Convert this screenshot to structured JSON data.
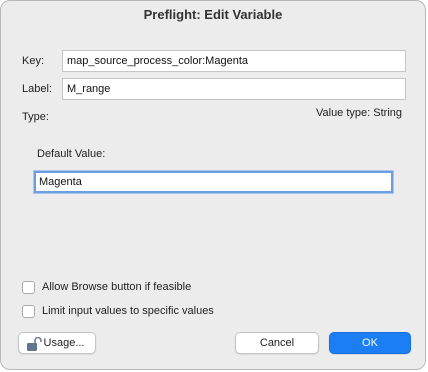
{
  "window": {
    "title": "Preflight: Edit Variable"
  },
  "form": {
    "key_label": "Key:",
    "key_value": "map_source_process_color:Magenta",
    "label_label": "Label:",
    "label_value": "M_range",
    "type_label": "Type:",
    "value_type": "Value type: String",
    "default_label": "Default Value:",
    "default_value": "Magenta"
  },
  "options": {
    "allow_browse": {
      "label": "Allow Browse button if feasible",
      "checked": false
    },
    "limit_values": {
      "label": "Limit input values to specific values",
      "checked": false
    }
  },
  "buttons": {
    "usage": "Usage...",
    "cancel": "Cancel",
    "ok": "OK"
  },
  "colors": {
    "accent": "#1b7ef3",
    "focus_ring": "#6d9ee0",
    "dialog_bg": "#ececec"
  },
  "icons": {
    "usage": "unlocked-padlock-icon"
  }
}
